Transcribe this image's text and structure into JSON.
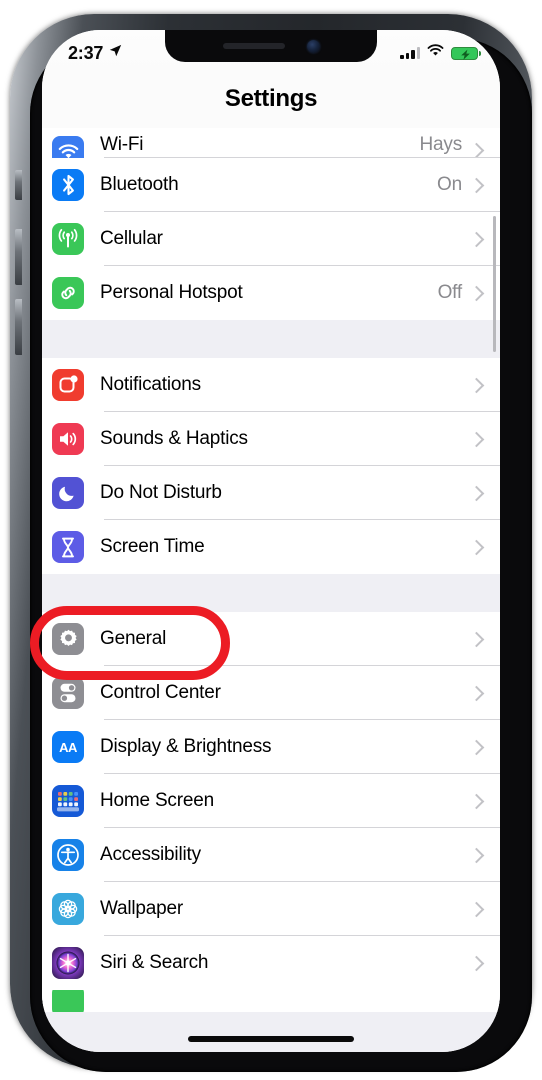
{
  "device": {
    "name": "iphone-x-style-phone"
  },
  "status_bar": {
    "time": "2:37",
    "location_icon": "location-arrow-icon",
    "signal_icon": "cellular-signal-icon",
    "wifi_icon": "wifi-icon",
    "battery_icon": "battery-charging-icon"
  },
  "nav": {
    "title": "Settings"
  },
  "groups": [
    {
      "id": "connectivity",
      "rows": [
        {
          "label": "Wi-Fi",
          "value": "Hays",
          "icon": "wifi-icon",
          "icon_class": "ic-wifi",
          "clipped": true
        },
        {
          "label": "Bluetooth",
          "value": "On",
          "icon": "bluetooth-icon",
          "icon_class": "ic-bt"
        },
        {
          "label": "Cellular",
          "value": "",
          "icon": "cellular-antenna-icon",
          "icon_class": "ic-cell"
        },
        {
          "label": "Personal Hotspot",
          "value": "Off",
          "icon": "hotspot-link-icon",
          "icon_class": "ic-hotspot"
        }
      ]
    },
    {
      "id": "alerts",
      "rows": [
        {
          "label": "Notifications",
          "value": "",
          "icon": "notifications-icon",
          "icon_class": "ic-notif"
        },
        {
          "label": "Sounds & Haptics",
          "value": "",
          "icon": "speaker-icon",
          "icon_class": "ic-sounds"
        },
        {
          "label": "Do Not Disturb",
          "value": "",
          "icon": "moon-icon",
          "icon_class": "ic-dnd"
        },
        {
          "label": "Screen Time",
          "value": "",
          "icon": "hourglass-icon",
          "icon_class": "ic-screentime"
        }
      ]
    },
    {
      "id": "system",
      "rows": [
        {
          "label": "General",
          "value": "",
          "icon": "gear-icon",
          "icon_class": "ic-general",
          "highlighted": true
        },
        {
          "label": "Control Center",
          "value": "",
          "icon": "toggles-icon",
          "icon_class": "ic-control"
        },
        {
          "label": "Display & Brightness",
          "value": "",
          "icon": "display-aa-icon",
          "icon_class": "ic-display"
        },
        {
          "label": "Home Screen",
          "value": "",
          "icon": "home-screen-grid-icon",
          "icon_class": "ic-home"
        },
        {
          "label": "Accessibility",
          "value": "",
          "icon": "accessibility-icon",
          "icon_class": "ic-access"
        },
        {
          "label": "Wallpaper",
          "value": "",
          "icon": "wallpaper-flower-icon",
          "icon_class": "ic-wallpaper"
        },
        {
          "label": "Siri & Search",
          "value": "",
          "icon": "siri-orb-icon",
          "icon_class": "ic-siri"
        }
      ]
    }
  ],
  "annotation": {
    "type": "ellipse-highlight",
    "target": "General",
    "color": "#ec1c24"
  },
  "home_indicator": {
    "name": "home-indicator-bar"
  }
}
